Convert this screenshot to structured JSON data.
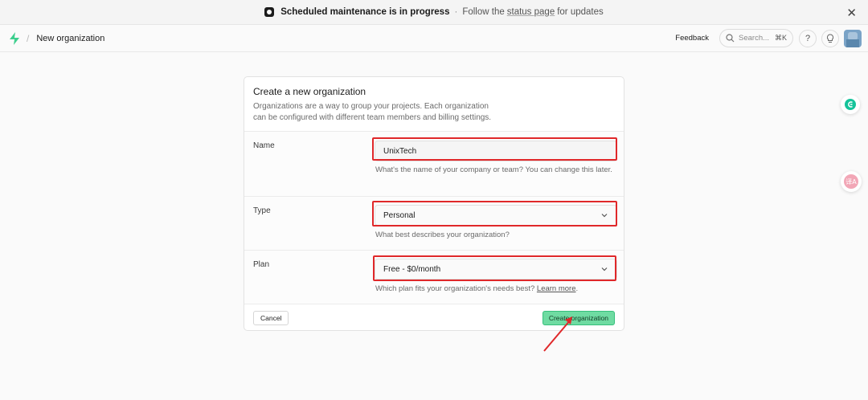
{
  "banner": {
    "title": "Scheduled maintenance is in progress",
    "separator": "·",
    "text_before": "Follow the",
    "link": "status page",
    "text_after": "for updates",
    "close": "✕"
  },
  "header": {
    "separator": "/",
    "breadcrumb": "New organization",
    "feedback": "Feedback",
    "search_placeholder": "Search...",
    "search_shortcut": "⌘K",
    "help_icon": "?",
    "accent": "#3ecf8e"
  },
  "form": {
    "title": "Create a new organization",
    "description": "Organizations are a way to group your projects. Each organization can be configured with different team members and billing settings.",
    "name": {
      "label": "Name",
      "value": "UnixTech",
      "help": "What's the name of your company or team? You can change this later."
    },
    "type": {
      "label": "Type",
      "value": "Personal",
      "help": "What best describes your organization?"
    },
    "plan": {
      "label": "Plan",
      "value": "Free - $0/month",
      "help": "Which plan fits your organization's needs best?",
      "link": "Learn more",
      "suffix": "."
    },
    "cancel": "Cancel",
    "create": "Create organization"
  },
  "widgets": {
    "translate_glyph": "译A"
  },
  "annotation_color": "#e0282a"
}
